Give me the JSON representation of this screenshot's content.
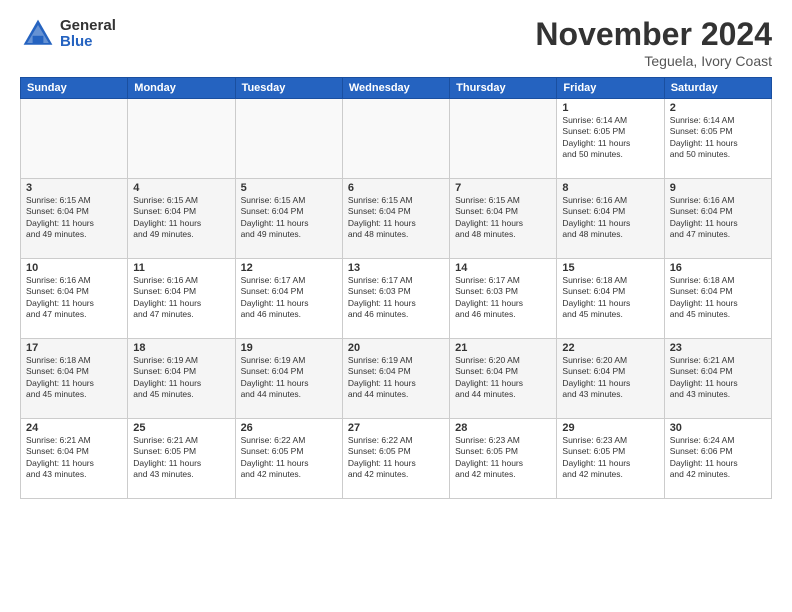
{
  "logo": {
    "general": "General",
    "blue": "Blue"
  },
  "title": {
    "month": "November 2024",
    "location": "Teguela, Ivory Coast"
  },
  "weekdays": [
    "Sunday",
    "Monday",
    "Tuesday",
    "Wednesday",
    "Thursday",
    "Friday",
    "Saturday"
  ],
  "weeks": [
    [
      {
        "day": "",
        "info": ""
      },
      {
        "day": "",
        "info": ""
      },
      {
        "day": "",
        "info": ""
      },
      {
        "day": "",
        "info": ""
      },
      {
        "day": "",
        "info": ""
      },
      {
        "day": "1",
        "info": "Sunrise: 6:14 AM\nSunset: 6:05 PM\nDaylight: 11 hours\nand 50 minutes."
      },
      {
        "day": "2",
        "info": "Sunrise: 6:14 AM\nSunset: 6:05 PM\nDaylight: 11 hours\nand 50 minutes."
      }
    ],
    [
      {
        "day": "3",
        "info": "Sunrise: 6:15 AM\nSunset: 6:04 PM\nDaylight: 11 hours\nand 49 minutes."
      },
      {
        "day": "4",
        "info": "Sunrise: 6:15 AM\nSunset: 6:04 PM\nDaylight: 11 hours\nand 49 minutes."
      },
      {
        "day": "5",
        "info": "Sunrise: 6:15 AM\nSunset: 6:04 PM\nDaylight: 11 hours\nand 49 minutes."
      },
      {
        "day": "6",
        "info": "Sunrise: 6:15 AM\nSunset: 6:04 PM\nDaylight: 11 hours\nand 48 minutes."
      },
      {
        "day": "7",
        "info": "Sunrise: 6:15 AM\nSunset: 6:04 PM\nDaylight: 11 hours\nand 48 minutes."
      },
      {
        "day": "8",
        "info": "Sunrise: 6:16 AM\nSunset: 6:04 PM\nDaylight: 11 hours\nand 48 minutes."
      },
      {
        "day": "9",
        "info": "Sunrise: 6:16 AM\nSunset: 6:04 PM\nDaylight: 11 hours\nand 47 minutes."
      }
    ],
    [
      {
        "day": "10",
        "info": "Sunrise: 6:16 AM\nSunset: 6:04 PM\nDaylight: 11 hours\nand 47 minutes."
      },
      {
        "day": "11",
        "info": "Sunrise: 6:16 AM\nSunset: 6:04 PM\nDaylight: 11 hours\nand 47 minutes."
      },
      {
        "day": "12",
        "info": "Sunrise: 6:17 AM\nSunset: 6:04 PM\nDaylight: 11 hours\nand 46 minutes."
      },
      {
        "day": "13",
        "info": "Sunrise: 6:17 AM\nSunset: 6:03 PM\nDaylight: 11 hours\nand 46 minutes."
      },
      {
        "day": "14",
        "info": "Sunrise: 6:17 AM\nSunset: 6:03 PM\nDaylight: 11 hours\nand 46 minutes."
      },
      {
        "day": "15",
        "info": "Sunrise: 6:18 AM\nSunset: 6:04 PM\nDaylight: 11 hours\nand 45 minutes."
      },
      {
        "day": "16",
        "info": "Sunrise: 6:18 AM\nSunset: 6:04 PM\nDaylight: 11 hours\nand 45 minutes."
      }
    ],
    [
      {
        "day": "17",
        "info": "Sunrise: 6:18 AM\nSunset: 6:04 PM\nDaylight: 11 hours\nand 45 minutes."
      },
      {
        "day": "18",
        "info": "Sunrise: 6:19 AM\nSunset: 6:04 PM\nDaylight: 11 hours\nand 45 minutes."
      },
      {
        "day": "19",
        "info": "Sunrise: 6:19 AM\nSunset: 6:04 PM\nDaylight: 11 hours\nand 44 minutes."
      },
      {
        "day": "20",
        "info": "Sunrise: 6:19 AM\nSunset: 6:04 PM\nDaylight: 11 hours\nand 44 minutes."
      },
      {
        "day": "21",
        "info": "Sunrise: 6:20 AM\nSunset: 6:04 PM\nDaylight: 11 hours\nand 44 minutes."
      },
      {
        "day": "22",
        "info": "Sunrise: 6:20 AM\nSunset: 6:04 PM\nDaylight: 11 hours\nand 43 minutes."
      },
      {
        "day": "23",
        "info": "Sunrise: 6:21 AM\nSunset: 6:04 PM\nDaylight: 11 hours\nand 43 minutes."
      }
    ],
    [
      {
        "day": "24",
        "info": "Sunrise: 6:21 AM\nSunset: 6:04 PM\nDaylight: 11 hours\nand 43 minutes."
      },
      {
        "day": "25",
        "info": "Sunrise: 6:21 AM\nSunset: 6:05 PM\nDaylight: 11 hours\nand 43 minutes."
      },
      {
        "day": "26",
        "info": "Sunrise: 6:22 AM\nSunset: 6:05 PM\nDaylight: 11 hours\nand 42 minutes."
      },
      {
        "day": "27",
        "info": "Sunrise: 6:22 AM\nSunset: 6:05 PM\nDaylight: 11 hours\nand 42 minutes."
      },
      {
        "day": "28",
        "info": "Sunrise: 6:23 AM\nSunset: 6:05 PM\nDaylight: 11 hours\nand 42 minutes."
      },
      {
        "day": "29",
        "info": "Sunrise: 6:23 AM\nSunset: 6:05 PM\nDaylight: 11 hours\nand 42 minutes."
      },
      {
        "day": "30",
        "info": "Sunrise: 6:24 AM\nSunset: 6:06 PM\nDaylight: 11 hours\nand 42 minutes."
      }
    ]
  ]
}
